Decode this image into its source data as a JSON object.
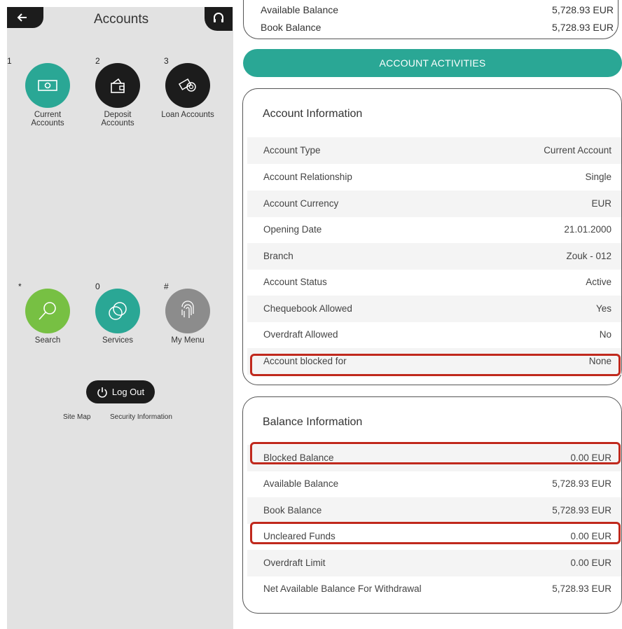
{
  "sidebar": {
    "title": "Accounts",
    "tiles": [
      {
        "number": "1",
        "label": "Current Accounts",
        "color": "#2aa795",
        "icon": "cash-icon"
      },
      {
        "number": "2",
        "label": "Deposit Accounts",
        "color": "#1c1c1c",
        "icon": "wallet-icon"
      },
      {
        "number": "3",
        "label": "Loan Accounts",
        "color": "#1c1c1c",
        "icon": "loan-icon"
      },
      {
        "number": "*",
        "label": "Search",
        "color": "#77c043",
        "icon": "search-icon"
      },
      {
        "number": "0",
        "label": "Services",
        "color": "#2aa795",
        "icon": "services-icon"
      },
      {
        "number": "#",
        "label": "My Menu",
        "color": "#8c8c8c",
        "icon": "fingerprint-icon"
      }
    ],
    "logout_label": "Log Out",
    "site_map": "Site Map",
    "security_info": "Security Information"
  },
  "summary": {
    "available_label": "Available Balance",
    "available_value": "5,728.93 EUR",
    "book_label": "Book Balance",
    "book_value": "5,728.93 EUR"
  },
  "activities_button": "ACCOUNT ACTIVITIES",
  "account_info": {
    "title": "Account Information",
    "rows": [
      {
        "label": "Account Type",
        "value": "Current Account"
      },
      {
        "label": "Account Relationship",
        "value": "Single"
      },
      {
        "label": "Account Currency",
        "value": "EUR"
      },
      {
        "label": "Opening Date",
        "value": "21.01.2000"
      },
      {
        "label": "Branch",
        "value": "Zouk - 012"
      },
      {
        "label": "Account Status",
        "value": "Active"
      },
      {
        "label": "Chequebook Allowed",
        "value": "Yes"
      },
      {
        "label": "Overdraft Allowed",
        "value": "No"
      },
      {
        "label": "Account blocked for",
        "value": "None"
      }
    ]
  },
  "balance_info": {
    "title": "Balance Information",
    "rows": [
      {
        "label": "Blocked Balance",
        "value": "0.00 EUR"
      },
      {
        "label": "Available Balance",
        "value": "5,728.93 EUR"
      },
      {
        "label": "Book Balance",
        "value": "5,728.93 EUR"
      },
      {
        "label": "Uncleared Funds",
        "value": "0.00 EUR"
      },
      {
        "label": "Overdraft Limit",
        "value": "0.00 EUR"
      },
      {
        "label": "Net Available Balance For Withdrawal",
        "value": "5,728.93 EUR"
      }
    ]
  },
  "colors": {
    "accent": "#2aa795",
    "highlight": "#c0291d",
    "dark": "#1c1c1c"
  }
}
